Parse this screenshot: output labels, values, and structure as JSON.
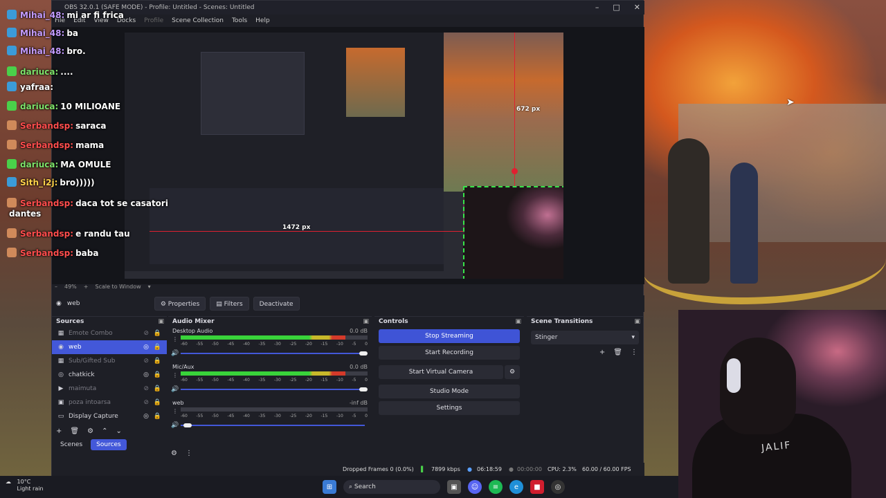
{
  "window": {
    "title": "OBS 32.0.1 (SAFE MODE) - Profile: Untitled - Scenes: Untitled",
    "menu": [
      "File",
      "Edit",
      "View",
      "Docks",
      "Profile",
      "Scene Collection",
      "Tools",
      "Help"
    ]
  },
  "preview": {
    "height_label": "672 px",
    "width_label": "1472 px",
    "zoom": "49%",
    "scale_mode": "Scale to Window"
  },
  "source_toolbar": {
    "selected_source": "web",
    "properties": "Properties",
    "filters": "Filters",
    "deactivate": "Deactivate"
  },
  "sources": {
    "title": "Sources",
    "items": [
      {
        "name": "Emote Combo",
        "visible": false
      },
      {
        "name": "web",
        "visible": true,
        "selected": true
      },
      {
        "name": "Sub/Gifted Sub",
        "visible": false
      },
      {
        "name": "chatkick",
        "visible": true
      },
      {
        "name": "maimuta",
        "visible": false
      },
      {
        "name": "poza intoarsa",
        "visible": false
      },
      {
        "name": "Display Capture",
        "visible": true
      }
    ],
    "tabs": [
      "Scenes",
      "Sources"
    ]
  },
  "audio_mixer": {
    "title": "Audio Mixer",
    "channels": [
      {
        "name": "Desktop Audio",
        "db": "0.0 dB",
        "level": 0.88
      },
      {
        "name": "Mic/Aux",
        "db": "0.0 dB",
        "level": 0.88
      },
      {
        "name": "web",
        "db": "-inf dB",
        "level": 0.0
      }
    ],
    "ticks": [
      "-60",
      "-55",
      "-50",
      "-45",
      "-40",
      "-35",
      "-30",
      "-25",
      "-20",
      "-15",
      "-10",
      "-5",
      "0"
    ]
  },
  "controls": {
    "title": "Controls",
    "stop_streaming": "Stop Streaming",
    "start_recording": "Start Recording",
    "start_virtual_camera": "Start Virtual Camera",
    "studio_mode": "Studio Mode",
    "settings": "Settings"
  },
  "scene_transitions": {
    "title": "Scene Transitions",
    "selected": "Stinger"
  },
  "status": {
    "dropped_frames": "Dropped Frames 0 (0.0%)",
    "bitrate": "7899 kbps",
    "stream_time": "06:18:59",
    "rec_time": "00:00:00",
    "cpu": "CPU: 2.3%",
    "fps": "60.00 / 60.00 FPS"
  },
  "chat": [
    {
      "user": "Mihai_48:",
      "text": "mi ar fi frica",
      "color": "#c49cff"
    },
    {
      "user": "Mihai_48:",
      "text": "ba",
      "color": "#c49cff"
    },
    {
      "user": "Mihai_48:",
      "text": "bro.",
      "color": "#c49cff"
    },
    {
      "user": "dariuca:",
      "text": "....",
      "color": "#7ee26a"
    },
    {
      "user": "yafraa:",
      "text": "",
      "color": "#ffffff"
    },
    {
      "user": "dariuca:",
      "text": "10 MILIOANE",
      "color": "#7ee26a"
    },
    {
      "user": "Serbandsp:",
      "text": "saraca",
      "color": "#ff4d4d"
    },
    {
      "user": "Serbandsp:",
      "text": "mama",
      "color": "#ff4d4d"
    },
    {
      "user": "dariuca:",
      "text": "MA OMULE",
      "color": "#7ee26a"
    },
    {
      "user": "Sith_i2j:",
      "text": "bro)))))",
      "color": "#ffd24a"
    },
    {
      "user": "Serbandsp:",
      "text": "daca tot se casatori",
      "color": "#ff4d4d"
    },
    {
      "user": "",
      "text": "dantes",
      "color": "#ffffff"
    },
    {
      "user": "Serbandsp:",
      "text": "e randu tau",
      "color": "#ff4d4d"
    },
    {
      "user": "Serbandsp:",
      "text": "baba",
      "color": "#ff4d4d"
    }
  ],
  "taskbar": {
    "temp": "10°C",
    "weather": "Light rain",
    "search": "Search"
  },
  "webcam_shirt": "JALIF"
}
